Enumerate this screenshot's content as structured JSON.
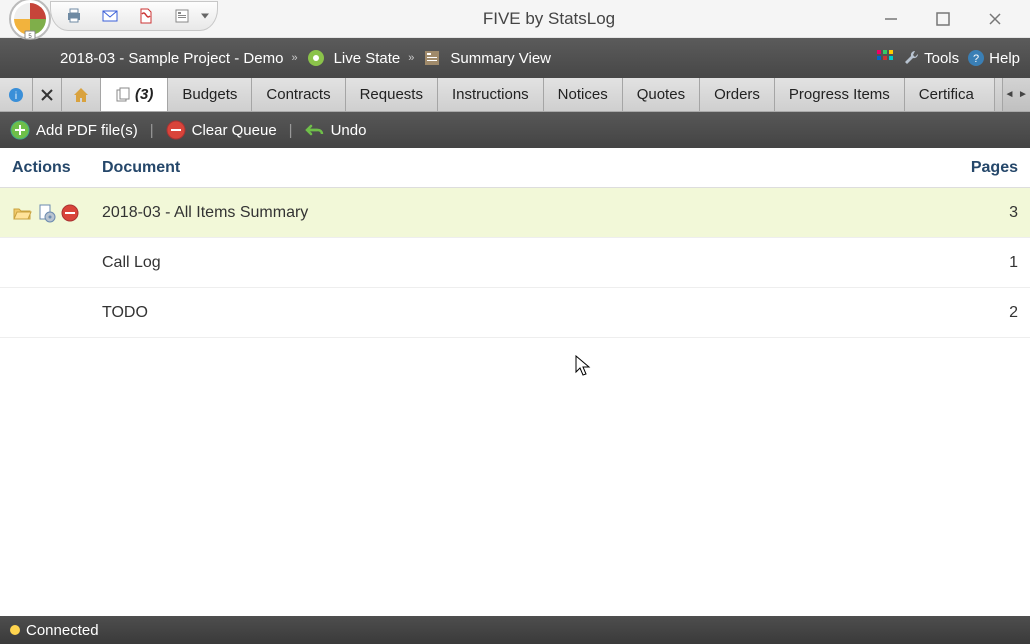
{
  "window": {
    "title": "FIVE by StatsLog"
  },
  "breadcrumb": {
    "project": "2018-03 - Sample Project - Demo",
    "state": "Live State",
    "view": "Summary View"
  },
  "nav": {
    "tools_label": "Tools",
    "help_label": "Help"
  },
  "tabs": {
    "count_label": "(3)",
    "items": [
      "Budgets",
      "Contracts",
      "Requests",
      "Instructions",
      "Notices",
      "Quotes",
      "Orders",
      "Progress Items",
      "Certifica"
    ]
  },
  "toolbar": {
    "add_pdf": "Add PDF file(s)",
    "clear_queue": "Clear Queue",
    "undo": "Undo"
  },
  "table": {
    "headers": {
      "actions": "Actions",
      "document": "Document",
      "pages": "Pages"
    },
    "rows": [
      {
        "doc": "2018-03 - All Items Summary",
        "pages": "3",
        "selected": true
      },
      {
        "doc": "Call Log",
        "pages": "1",
        "selected": false
      },
      {
        "doc": "TODO",
        "pages": "2",
        "selected": false
      }
    ]
  },
  "status": {
    "text": "Connected"
  }
}
